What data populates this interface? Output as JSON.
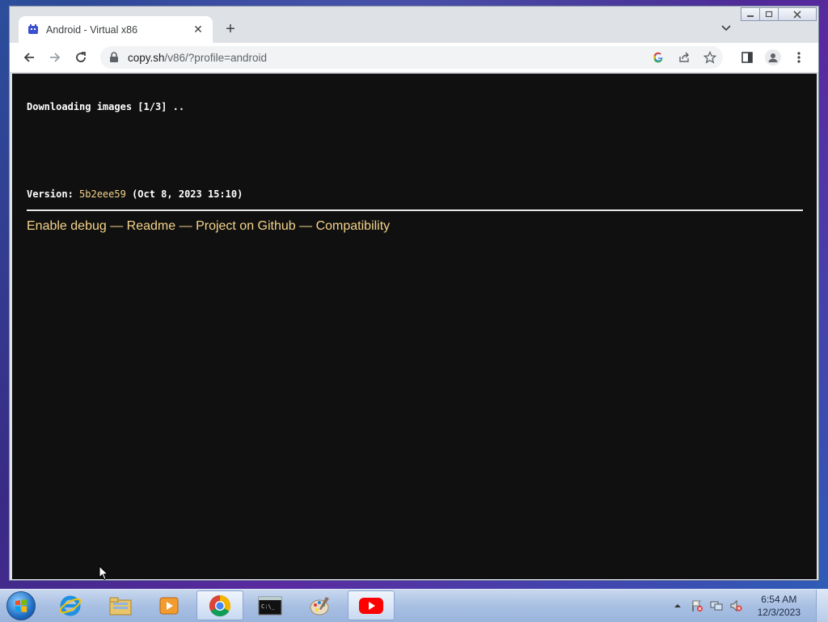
{
  "browser": {
    "tab": {
      "title": "Android - Virtual x86"
    },
    "url": {
      "host": "copy.sh",
      "path": "/v86/?profile=android"
    }
  },
  "page": {
    "status": "Downloading images [1/3] ..",
    "version_label": "Version:",
    "version_hash": "5b2eee59",
    "version_date": "(Oct 8, 2023 15:10)",
    "links": [
      "Enable debug",
      "Readme",
      "Project on Github",
      "Compatibility"
    ],
    "separator": "—"
  },
  "taskbar": {
    "apps": [
      "internet-explorer",
      "file-explorer",
      "media-player",
      "chrome",
      "command-prompt",
      "paint",
      "youtube"
    ],
    "clock": {
      "time": "6:54 AM",
      "date": "12/3/2023"
    }
  },
  "colors": {
    "link": "#f5d38a",
    "page_bg": "#101010",
    "accent_red": "#ff0000"
  }
}
